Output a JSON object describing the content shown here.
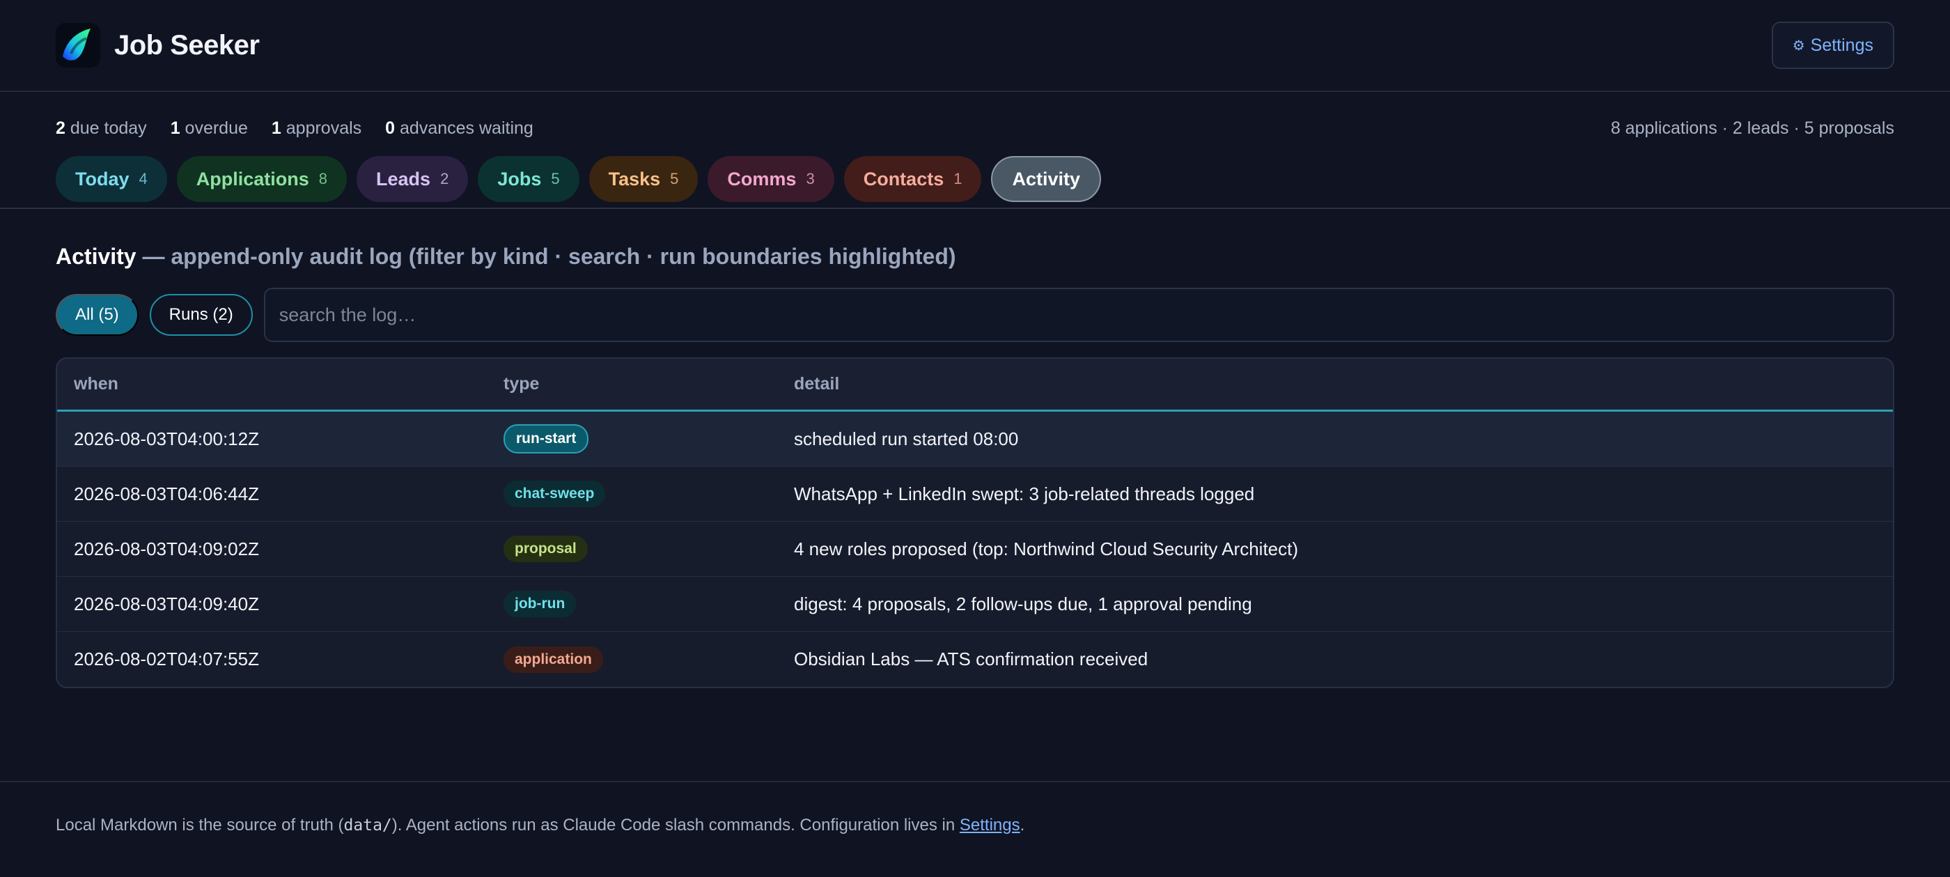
{
  "app": {
    "title": "Job Seeker",
    "settings_label": "Settings"
  },
  "stats": [
    {
      "value": "2",
      "label": "due today"
    },
    {
      "value": "1",
      "label": "overdue"
    },
    {
      "value": "1",
      "label": "approvals"
    },
    {
      "value": "0",
      "label": "advances waiting"
    }
  ],
  "summary": "8 applications · 2 leads · 5 proposals",
  "tabs": [
    {
      "label": "Today",
      "count": "4"
    },
    {
      "label": "Applications",
      "count": "8"
    },
    {
      "label": "Leads",
      "count": "2"
    },
    {
      "label": "Jobs",
      "count": "5"
    },
    {
      "label": "Tasks",
      "count": "5"
    },
    {
      "label": "Comms",
      "count": "3"
    },
    {
      "label": "Contacts",
      "count": "1"
    },
    {
      "label": "Activity",
      "active": true
    }
  ],
  "section": {
    "title": "Activity",
    "subtitle": "— append-only audit log (filter by kind · search · run boundaries highlighted)"
  },
  "filters": {
    "all_label": "All (5)",
    "runs_label": "Runs (2)",
    "search_placeholder": "search the log…"
  },
  "table": {
    "headers": {
      "when": "when",
      "type": "type",
      "detail": "detail"
    },
    "rows": [
      {
        "when": "2026-08-03T04:00:12Z",
        "type": "run-start",
        "detail": "scheduled run started 08:00"
      },
      {
        "when": "2026-08-03T04:06:44Z",
        "type": "chat-sweep",
        "detail": "WhatsApp + LinkedIn swept: 3 job-related threads logged"
      },
      {
        "when": "2026-08-03T04:09:02Z",
        "type": "proposal",
        "detail": "4 new roles proposed (top: Northwind Cloud Security Architect)"
      },
      {
        "when": "2026-08-03T04:09:40Z",
        "type": "job-run",
        "detail": "digest: 4 proposals, 2 follow-ups due, 1 approval pending"
      },
      {
        "when": "2026-08-02T04:07:55Z",
        "type": "application",
        "detail": "Obsidian Labs — ATS confirmation received"
      }
    ]
  },
  "footer": {
    "text_before": "Local Markdown is the source of truth (",
    "code": "data/",
    "text_middle": "). Agent actions run as Claude Code slash commands. Configuration lives in ",
    "link": "Settings",
    "text_after": "."
  }
}
